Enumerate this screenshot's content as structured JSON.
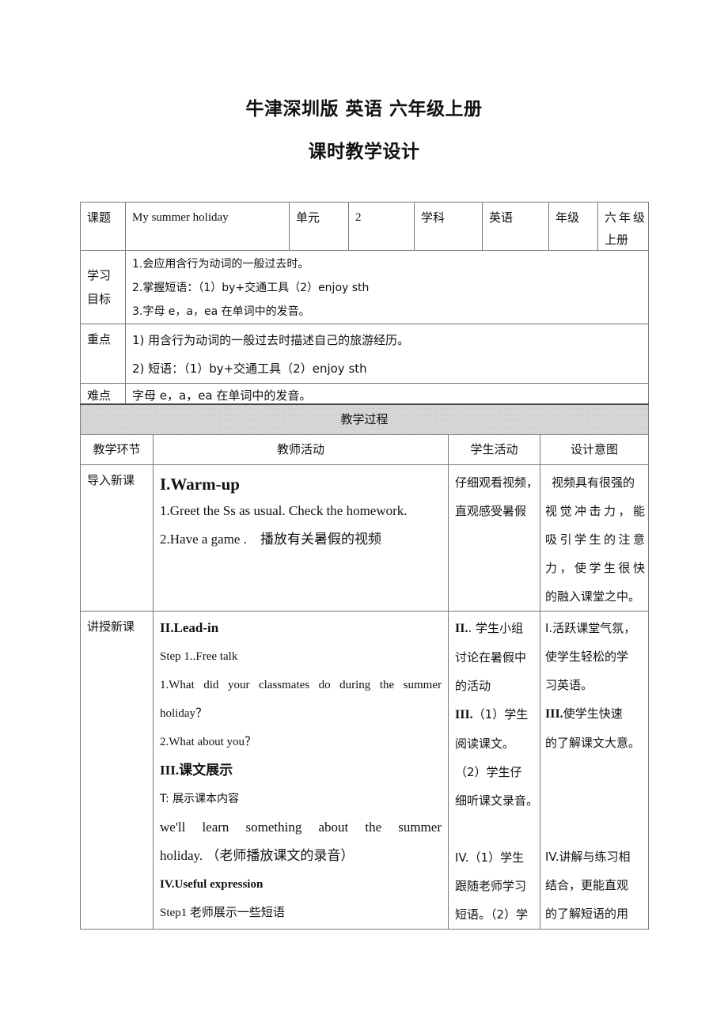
{
  "header": {
    "title": "牛津深圳版  英语  六年级上册",
    "subtitle": "课时教学设计"
  },
  "info_table": {
    "topic_label": "课题",
    "topic_value": "My summer holiday",
    "unit_label": "单元",
    "unit_value": "2",
    "subject_label": "学科",
    "subject_value": "英语",
    "grade_label": "年级",
    "grade_value_line1": "六年级",
    "grade_value_line2": "上册",
    "objectives_label_line1": "学习",
    "objectives_label_line2": "目标",
    "objectives": [
      "1.会应用含行为动词的一般过去时。",
      "2.掌握短语：（1）by+交通工具（2）enjoy sth",
      "3.字母 e，a，ea 在单词中的发音。"
    ],
    "key_points_label": "重点",
    "key_points": [
      "1)  用含行为动词的一般过去时描述自己的旅游经历。",
      "2)  短语：（1）by+交通工具（2）enjoy sth"
    ],
    "difficulty_label": "难点",
    "difficulty": "字母 e，a，ea 在单词中的发音。"
  },
  "process_table": {
    "section_title": "教学过程",
    "columns": [
      "教学环节",
      "教师活动",
      "学生活动",
      "设计意图"
    ],
    "rows": [
      {
        "stage": "导入新课",
        "teacher": {
          "heading": "I.Warm-up",
          "lines": [
            "1.Greet the Ss as usual. Check the homework.",
            "2.Have a game .    播放有关暑假的视频"
          ]
        },
        "student": [
          "仔细观看视频，",
          "直观感受暑假"
        ],
        "intent": [
          "视频具有很强的",
          "视觉冲击力，能",
          "吸引学生的注意",
          "力，使学生很快",
          "的融入课堂之中。"
        ]
      },
      {
        "stage": "讲授新课",
        "teacher": {
          "heading": "II.Lead-in",
          "lines": [
            "Step 1..Free talk",
            "1.What did your classmates do during the summer",
            "holiday？",
            "2.What about you？"
          ],
          "heading2": "III.课文展示",
          "lines2": [
            "T:  展示课本内容",
            "we'll learn something about the summer",
            "holiday. （老师播放课文的录音）"
          ],
          "heading3": "IV.Useful expression",
          "lines3": [
            "Step1 老师展示一些短语"
          ]
        },
        "student": [
          {
            "bold": "II.",
            "text": ". 学生小组"
          },
          {
            "bold": "",
            "text": "讨论在暑假中"
          },
          {
            "bold": "",
            "text": "的活动"
          },
          {
            "bold": "III.",
            "text": "（1）学生"
          },
          {
            "bold": "",
            "text": "阅读课文。"
          },
          {
            "bold": "",
            "text": "（2）学生仔"
          },
          {
            "bold": "",
            "text": "细听课文录音。"
          },
          {
            "bold": "",
            "text": ""
          },
          {
            "bold": "",
            "text": "IV.（1）学生"
          },
          {
            "bold": "",
            "text": "跟随老师学习"
          },
          {
            "bold": "",
            "text": "短语。（2）学"
          }
        ],
        "intent": [
          {
            "bold": "",
            "text": "I.活跃课堂气氛，"
          },
          {
            "bold": "",
            "text": "使学生轻松的学"
          },
          {
            "bold": "",
            "text": "习英语。"
          },
          {
            "bold": "III.",
            "text": "使学生快速"
          },
          {
            "bold": "",
            "text": "的了解课文大意。"
          },
          {
            "bold": "",
            "text": ""
          },
          {
            "bold": "",
            "text": ""
          },
          {
            "bold": "",
            "text": ""
          },
          {
            "bold": "",
            "text": "IV.讲解与练习相"
          },
          {
            "bold": "",
            "text": "结合，更能直观"
          },
          {
            "bold": "",
            "text": "的了解短语的用"
          }
        ]
      }
    ]
  }
}
